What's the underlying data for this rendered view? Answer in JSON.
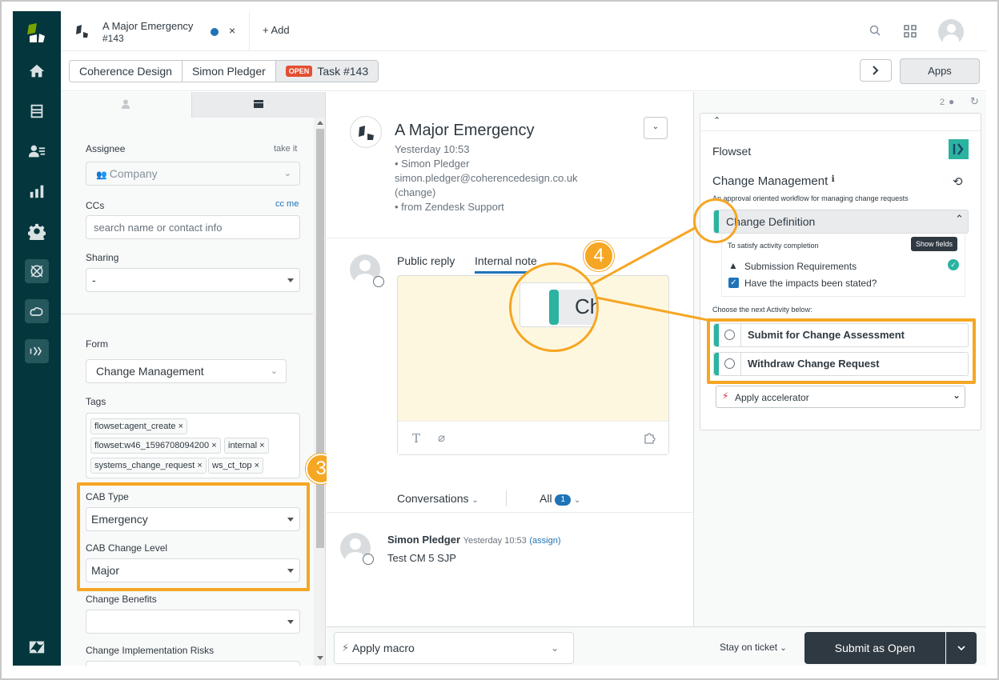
{
  "tab": {
    "title": "A Major Emergency",
    "subtitle": "#143",
    "close": "×",
    "add_label": "Add"
  },
  "breadcrumbs": {
    "org": "Coherence Design",
    "requester": "Simon Pledger",
    "status_badge": "OPEN",
    "task": "Task #143"
  },
  "header": {
    "apps_label": "Apps"
  },
  "left": {
    "assignee_label": "Assignee",
    "take_it": "take it",
    "assignee_value": "Company",
    "ccs_label": "CCs",
    "cc_me": "cc me",
    "ccs_placeholder": "search name or contact info",
    "sharing_label": "Sharing",
    "sharing_value": "-",
    "form_label": "Form",
    "form_value": "Change Management",
    "tags_label": "Tags",
    "tags": [
      "flowset:agent_create",
      "flowset:w46_1596708094200",
      "internal",
      "systems_change_request",
      "ws_ct_top"
    ],
    "cab_type_label": "CAB Type",
    "cab_type_value": "Emergency",
    "cab_level_label": "CAB Change Level",
    "cab_level_value": "Major",
    "benefits_label": "Change Benefits",
    "benefits_value": "",
    "risks_label": "Change Implementation Risks"
  },
  "ticket": {
    "title": "A Major Emergency",
    "time": "Yesterday 10:53",
    "requester": "• Simon Pledger",
    "email": "simon.pledger@coherencedesign.co.uk",
    "change_link": "(change)",
    "source": "• from Zendesk Support",
    "public_reply": "Public reply",
    "internal_note": "Internal note",
    "zoom_text": "Ch",
    "conversations_label": "Conversations",
    "all_label": "All",
    "all_count": "1",
    "comment_author": "Simon Pledger",
    "comment_time": "Yesterday 10:53",
    "comment_assign": "(assign)",
    "comment_body": "Test CM 5 SJP"
  },
  "right": {
    "viewer_count": "2",
    "flowset_label": "Flowset",
    "workflow_title": "Change Management",
    "workflow_desc": "An approval oriented workflow for managing change requests",
    "stage_name": "Change Definition",
    "completion_label": "To satisfy activity completion",
    "show_fields": "Show fields",
    "req1": "Submission Requirements",
    "req2": "Have the impacts been stated?",
    "next_label": "Choose the next Activity below:",
    "activity1": "Submit for Change Assessment",
    "activity2": "Withdraw Change Request",
    "accelerator": "Apply accelerator"
  },
  "bottom": {
    "macro_label": "Apply macro",
    "stay_label": "Stay on ticket",
    "submit_label": "Submit as Open"
  },
  "annotations": {
    "badge3": "3",
    "badge4": "4"
  },
  "colors": {
    "nav_bg": "#03363d",
    "highlight": "#f5a623",
    "teal": "#2bb3a1",
    "link": "#1f73b7",
    "open_badge": "#e34f32",
    "note_bg": "#fef7e0"
  }
}
